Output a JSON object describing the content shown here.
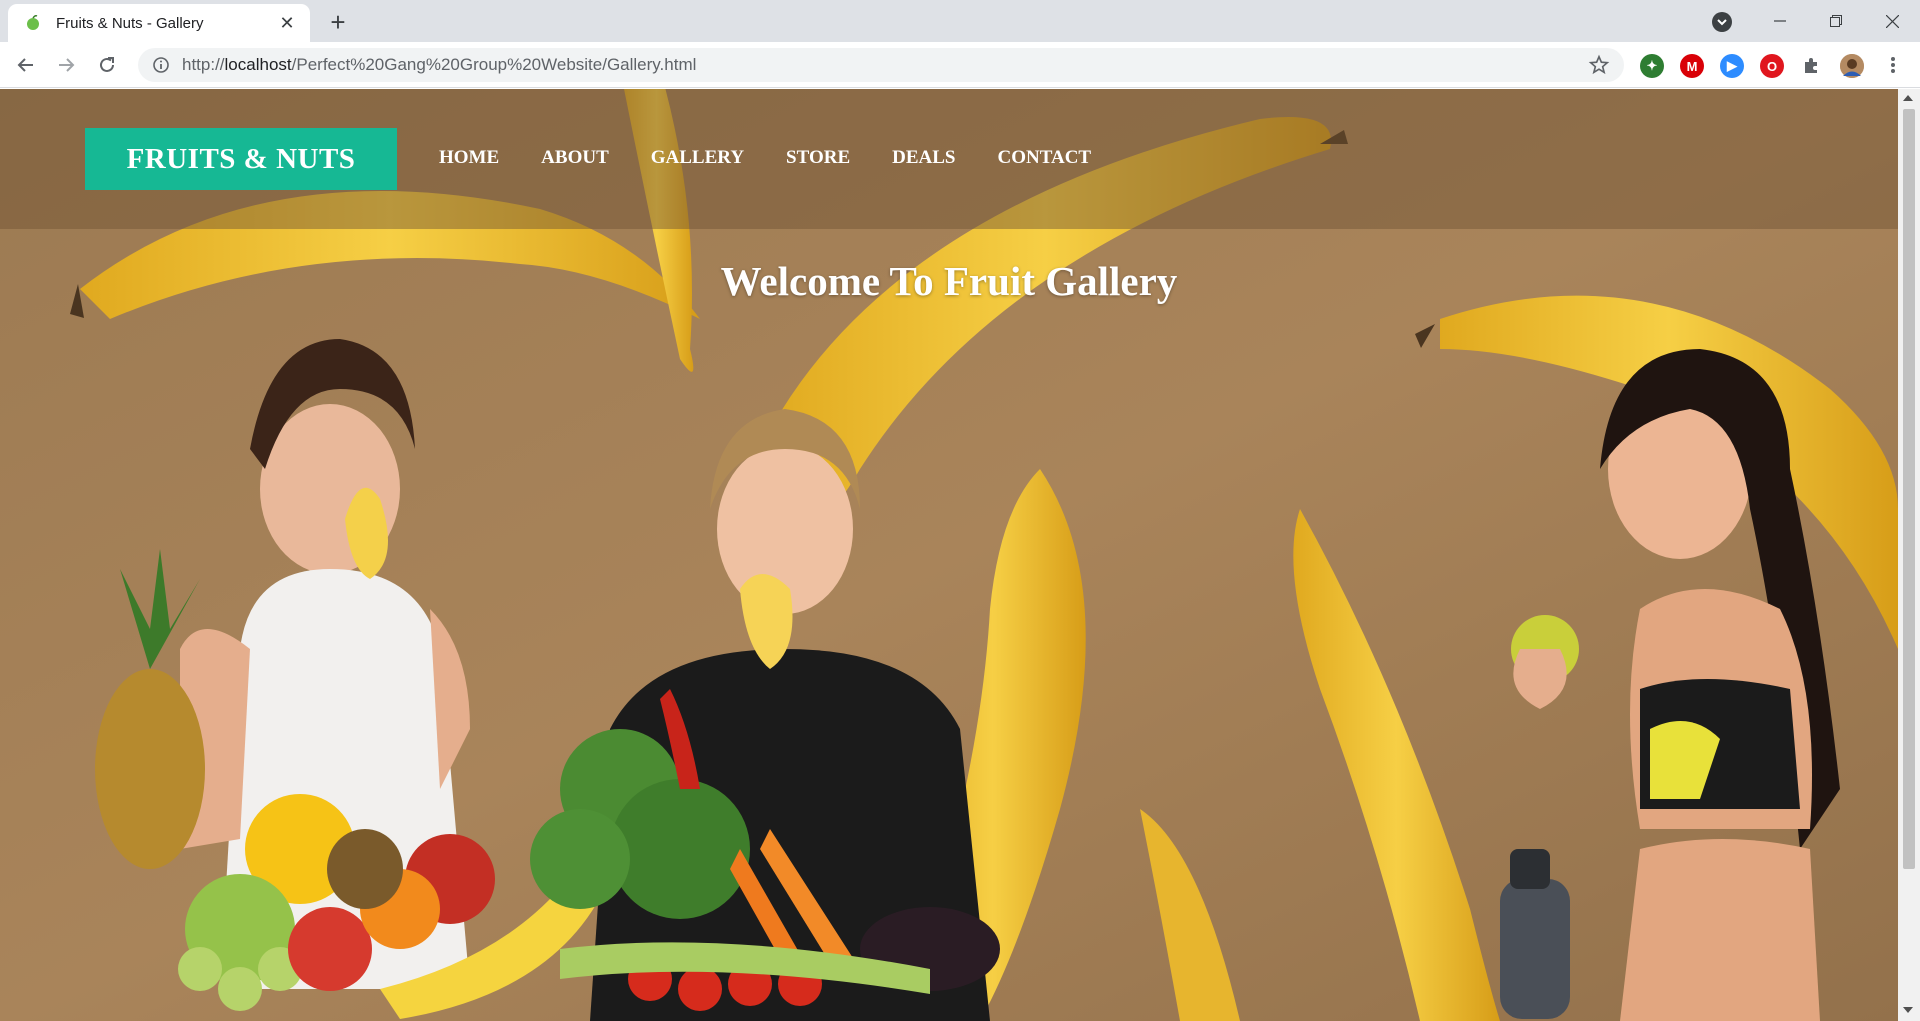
{
  "browser": {
    "tab_title": "Fruits & Nuts - Gallery",
    "url_prefix": "http://",
    "url_host": "localhost",
    "url_path": "/Perfect%20Gang%20Group%20Website/Gallery.html",
    "icons": [
      "back-arrow-icon",
      "forward-arrow-icon",
      "reload-icon",
      "info-icon",
      "star-icon",
      "puzzle-icon",
      "menu-dots-icon"
    ],
    "extensions": [
      {
        "name": "translate-extension-icon",
        "color": "#2e7d32",
        "glyph": "✦"
      },
      {
        "name": "mega-extension-icon",
        "color": "#d90007",
        "glyph": "M"
      },
      {
        "name": "zoom-extension-icon",
        "color": "#2d8cff",
        "glyph": "▶"
      },
      {
        "name": "opera-extension-icon",
        "color": "#e0161e",
        "glyph": "O"
      }
    ]
  },
  "site": {
    "logo": "FRUITS & NUTS",
    "nav": [
      "HOME",
      "ABOUT",
      "GALLERY",
      "STORE",
      "DEALS",
      "CONTACT"
    ],
    "heading": "Welcome To Fruit Gallery",
    "colors": {
      "logo_bg": "#16b894",
      "background": "#a47f56",
      "banana": "#f2c53d"
    }
  }
}
